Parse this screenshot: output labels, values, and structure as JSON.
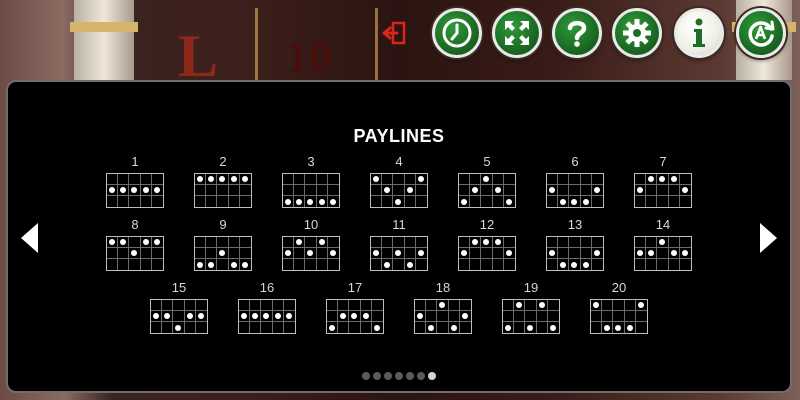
{
  "panel": {
    "title": "PAYLINES",
    "paylines": [
      {
        "number": "1",
        "rows": [
          1,
          1,
          1,
          1,
          1
        ]
      },
      {
        "number": "2",
        "rows": [
          0,
          0,
          0,
          0,
          0
        ]
      },
      {
        "number": "3",
        "rows": [
          2,
          2,
          2,
          2,
          2
        ]
      },
      {
        "number": "4",
        "rows": [
          0,
          1,
          2,
          1,
          0
        ]
      },
      {
        "number": "5",
        "rows": [
          2,
          1,
          0,
          1,
          2
        ]
      },
      {
        "number": "6",
        "rows": [
          1,
          2,
          2,
          2,
          1
        ]
      },
      {
        "number": "7",
        "rows": [
          1,
          0,
          0,
          0,
          1
        ]
      },
      {
        "number": "8",
        "rows": [
          0,
          0,
          1,
          0,
          0
        ]
      },
      {
        "number": "9",
        "rows": [
          2,
          2,
          1,
          2,
          2
        ]
      },
      {
        "number": "10",
        "rows": [
          1,
          0,
          1,
          0,
          1
        ]
      },
      {
        "number": "11",
        "rows": [
          1,
          2,
          1,
          2,
          1
        ]
      },
      {
        "number": "12",
        "rows": [
          1,
          0,
          0,
          0,
          1
        ]
      },
      {
        "number": "13",
        "rows": [
          1,
          2,
          2,
          2,
          1
        ]
      },
      {
        "number": "14",
        "rows": [
          1,
          1,
          0,
          1,
          1
        ]
      },
      {
        "number": "15",
        "rows": [
          1,
          1,
          2,
          1,
          1
        ]
      },
      {
        "number": "16",
        "rows": [
          1,
          1,
          1,
          1,
          1
        ]
      },
      {
        "number": "17",
        "rows": [
          2,
          1,
          1,
          1,
          2
        ]
      },
      {
        "number": "18",
        "rows": [
          1,
          2,
          0,
          2,
          1
        ]
      },
      {
        "number": "19",
        "rows": [
          2,
          0,
          2,
          0,
          2
        ]
      },
      {
        "number": "20",
        "rows": [
          0,
          2,
          2,
          2,
          0
        ]
      }
    ],
    "page_count": 7,
    "active_page": 7
  },
  "toolbar": {
    "buttons": [
      {
        "name": "history-button",
        "icon": "clock-icon"
      },
      {
        "name": "fullscreen-button",
        "icon": "expand-arrows-icon"
      },
      {
        "name": "help-button",
        "icon": "question-mark-icon"
      },
      {
        "name": "settings-button",
        "icon": "gear-icon"
      },
      {
        "name": "info-button",
        "icon": "info-icon"
      },
      {
        "name": "autoplay-button",
        "icon": "autoplay-icon"
      }
    ],
    "exit_icon": "exit-door-icon"
  },
  "background_reels": {
    "symbol_l": "L",
    "symbol_ten": "10"
  },
  "colors": {
    "panel_bg": "#000000",
    "button_green": "#1d6e25",
    "exit_red": "#c8261c"
  }
}
